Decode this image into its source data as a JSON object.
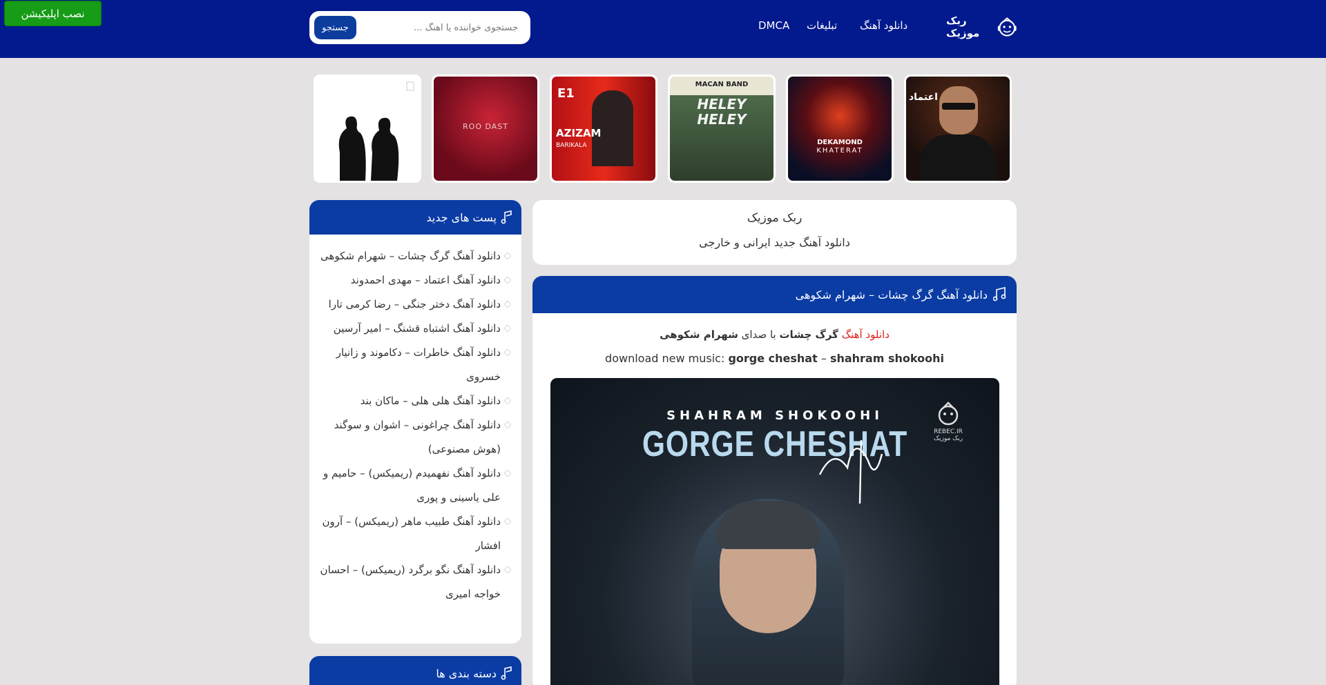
{
  "header": {
    "install_label": "نصب اپلیکیشن",
    "search_button": "جستجو",
    "search_placeholder": "جستجوی خواننده یا آهنگ ...",
    "nav": [
      "DMCA",
      "تبلیغات",
      "دانلود آهنگ"
    ],
    "logo_text": "ربک موزیک",
    "bg_color": "#021a8e"
  },
  "thumbnails": [
    {
      "caption": "",
      "sub": ""
    },
    {
      "caption": "ROO DAST",
      "sub": ""
    },
    {
      "caption": "AZIZAM",
      "sub": "BARIKALA"
    },
    {
      "caption": "HELEY",
      "sub": "HELEY"
    },
    {
      "caption": "DEKAMOND",
      "sub": "KHATERAT"
    },
    {
      "caption": "اعتماد",
      "sub": ""
    }
  ],
  "sidebar": {
    "new_posts_title": "پست های جدید",
    "new_posts": [
      "دانلود آهنگ گرگ چشات – شهرام شکوهی",
      "دانلود آهنگ اعتماد – مهدی احمدوند",
      "دانلود آهنگ دختر جنگی – رضا کرمی تارا",
      "دانلود آهنگ اشتباه قشنگ – امیر آرسین",
      "دانلود آهنگ خاطرات – دکاموند و زانیار خسروی",
      "دانلود آهنگ هلی هلی – ماکان بند",
      "دانلود آهنگ چراغونی – اشوان و سوگند (هوش مصنوعی)",
      "دانلود آهنگ نفهمیدم (ریمیکس) – حامیم و علی یاسینی و پوری",
      "دانلود آهنگ طبیب ماهر (ریمیکس) – آرون افشار",
      "دانلود آهنگ نگو برگرد (ریمیکس) – احسان خواجه امیری"
    ],
    "categories_title": "دسته بندی ها",
    "accent_color": "#0a3ca4"
  },
  "intro": {
    "title": "ربک موزیک",
    "subtitle": "دانلود آهنگ جدید ایرانی و خارجی"
  },
  "post": {
    "title": "دانلود آهنگ گرگ چشات – شهرام شکوهی",
    "line1_red": "دانلود آهنگ",
    "line1_song": "گرگ چشات",
    "line1_mid": "با صدای",
    "line1_artist": "شهرام شکوهی",
    "line2_prefix": "download new music:",
    "line2_song": "gorge cheshat",
    "line2_dash": "–",
    "line2_artist": "shahram shokoohi",
    "cover_artist": "SHAHRAM SHOKOOHI",
    "cover_title": "GORGE CHESHAT",
    "cover_brand": "REBEC.IR",
    "cover_brand_fa": "ربک موزیک"
  }
}
